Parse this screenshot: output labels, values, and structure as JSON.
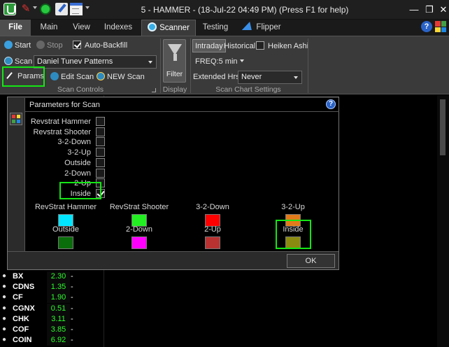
{
  "window": {
    "title": "5 - HAMMER - (18-Jul-22 04:49 PM) (Press F1 for help)",
    "controls": [
      "minimize-icon",
      "restore-icon",
      "close-icon"
    ]
  },
  "tabs": {
    "file": "File",
    "main": "Main",
    "view": "View",
    "indexes": "Indexes",
    "scanner": "Scanner",
    "testing": "Testing",
    "flipper": "Flipper"
  },
  "ribbon": {
    "scan_controls": {
      "start": "Start",
      "stop": "Stop",
      "auto_backfill": "Auto-Backfill",
      "auto_backfill_checked": true,
      "scan_label": "Scan",
      "scan_value": "Daniel Tunev Patterns",
      "params": "Params",
      "edit_scan": "Edit Scan",
      "new_scan": "NEW Scan",
      "group": "Scan Controls"
    },
    "display": {
      "filter": "Filter",
      "group": "Display"
    },
    "chart_settings": {
      "intraday": "Intraday",
      "historical": "Historical",
      "heiken_ashi": "Heiken Ashi",
      "heiken_checked": false,
      "freq": "FREQ:5 min",
      "extended_label": "Extended Hrs:",
      "extended_value": "Never",
      "group": "Scan Chart Settings"
    }
  },
  "dialog": {
    "title": "Parameters for Scan",
    "params": [
      {
        "label": "Revstrat Hammer",
        "checked": false
      },
      {
        "label": "Revstrat Shooter",
        "checked": false
      },
      {
        "label": "3-2-Down",
        "checked": false
      },
      {
        "label": "3-2-Up",
        "checked": false
      },
      {
        "label": "Outside",
        "checked": false
      },
      {
        "label": "2-Down",
        "checked": false
      },
      {
        "label": "2-Up",
        "checked": false
      },
      {
        "label": "Inside",
        "checked": true
      }
    ],
    "colors": [
      {
        "label": "RevStrat Hammer",
        "color": "#00e5ff"
      },
      {
        "label": "RevStrat Shooter",
        "color": "#22ee22"
      },
      {
        "label": "3-2-Down",
        "color": "#ff0000"
      },
      {
        "label": "3-2-Up",
        "color": "#e07a1a"
      },
      {
        "label": "Outside",
        "color": "#0a6e0a"
      },
      {
        "label": "2-Down",
        "color": "#ff00ff"
      },
      {
        "label": "2-Up",
        "color": "#b83232"
      },
      {
        "label": "Inside",
        "color": "#8a8a10"
      }
    ],
    "ok": "OK"
  },
  "watchlist": [
    {
      "symbol": "BX",
      "value": "2.30",
      "dash": "-"
    },
    {
      "symbol": "CDNS",
      "value": "1.35",
      "dash": "-"
    },
    {
      "symbol": "CF",
      "value": "1.90",
      "dash": "-"
    },
    {
      "symbol": "CGNX",
      "value": "0.51",
      "dash": "-"
    },
    {
      "symbol": "CHK",
      "value": "3.11",
      "dash": "-"
    },
    {
      "symbol": "COF",
      "value": "3.85",
      "dash": "-"
    },
    {
      "symbol": "COIN",
      "value": "6.92",
      "dash": "-"
    }
  ]
}
